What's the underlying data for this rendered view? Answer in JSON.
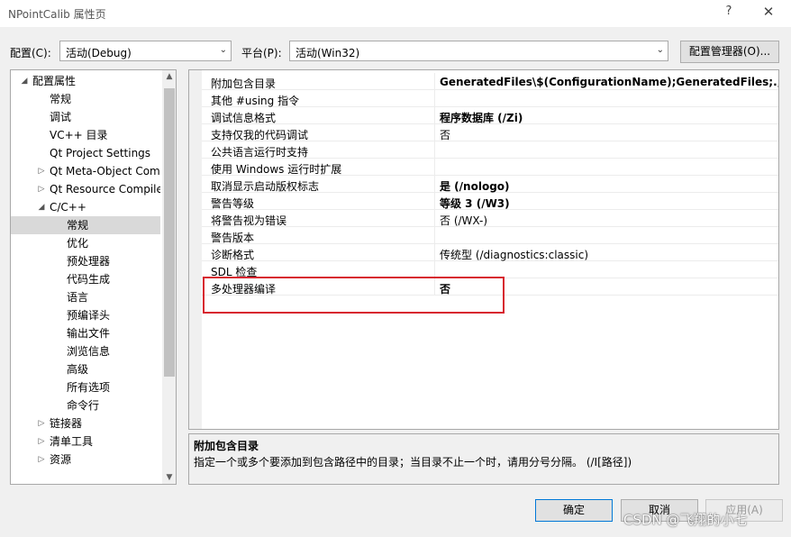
{
  "window": {
    "title": "NPointCalib 属性页",
    "help_glyph": "?",
    "close_glyph": "✕"
  },
  "config": {
    "config_label": "配置(C):",
    "config_value": "活动(Debug)",
    "platform_label": "平台(P):",
    "platform_value": "活动(Win32)",
    "manager_button": "配置管理器(O)..."
  },
  "tree": {
    "items": [
      {
        "label": "配置属性",
        "expander": "◢"
      },
      {
        "label": "常规",
        "expander": ""
      },
      {
        "label": "调试",
        "expander": ""
      },
      {
        "label": "VC++ 目录",
        "expander": ""
      },
      {
        "label": "Qt Project Settings",
        "expander": ""
      },
      {
        "label": "Qt Meta-Object Compiler",
        "expander": "▷"
      },
      {
        "label": "Qt Resource Compiler",
        "expander": "▷"
      },
      {
        "label": "C/C++",
        "expander": "◢"
      },
      {
        "label": "常规",
        "expander": ""
      },
      {
        "label": "优化",
        "expander": ""
      },
      {
        "label": "预处理器",
        "expander": ""
      },
      {
        "label": "代码生成",
        "expander": ""
      },
      {
        "label": "语言",
        "expander": ""
      },
      {
        "label": "预编译头",
        "expander": ""
      },
      {
        "label": "输出文件",
        "expander": ""
      },
      {
        "label": "浏览信息",
        "expander": ""
      },
      {
        "label": "高级",
        "expander": ""
      },
      {
        "label": "所有选项",
        "expander": ""
      },
      {
        "label": "命令行",
        "expander": ""
      },
      {
        "label": "链接器",
        "expander": "▷"
      },
      {
        "label": "清单工具",
        "expander": "▷"
      },
      {
        "label": "资源",
        "expander": "▷"
      }
    ],
    "selected_index": 8,
    "scroll_up": "▲",
    "scroll_down": "▼"
  },
  "grid": {
    "rows": [
      {
        "name": "附加包含目录",
        "value": "GeneratedFiles\\$(ConfigurationName);GeneratedFiles;.;..\\..\\..\\",
        "bold": true
      },
      {
        "name": "其他 #using 指令",
        "value": "",
        "bold": false
      },
      {
        "name": "调试信息格式",
        "value": "程序数据库 (/Zi)",
        "bold": true
      },
      {
        "name": "支持仅我的代码调试",
        "value": "否",
        "bold": false
      },
      {
        "name": "公共语言运行时支持",
        "value": "",
        "bold": false
      },
      {
        "name": "使用 Windows 运行时扩展",
        "value": "",
        "bold": false
      },
      {
        "name": "取消显示启动版权标志",
        "value": "是 (/nologo)",
        "bold": true
      },
      {
        "name": "警告等级",
        "value": "等级 3 (/W3)",
        "bold": true
      },
      {
        "name": "将警告视为错误",
        "value": "否 (/WX-)",
        "bold": false
      },
      {
        "name": "警告版本",
        "value": "",
        "bold": false
      },
      {
        "name": "诊断格式",
        "value": "传统型 (/diagnostics:classic)",
        "bold": false
      },
      {
        "name": "SDL 检查",
        "value": "",
        "bold": false
      },
      {
        "name": "多处理器编译",
        "value": "否",
        "bold": true
      }
    ]
  },
  "description": {
    "title": "附加包含目录",
    "text": "指定一个或多个要添加到包含路径中的目录；当目录不止一个时，请用分号分隔。     (/I[路径])"
  },
  "buttons": {
    "ok": "确定",
    "cancel": "取消",
    "apply": "应用(A)"
  },
  "watermark": "CSDN @飞翔的小七"
}
